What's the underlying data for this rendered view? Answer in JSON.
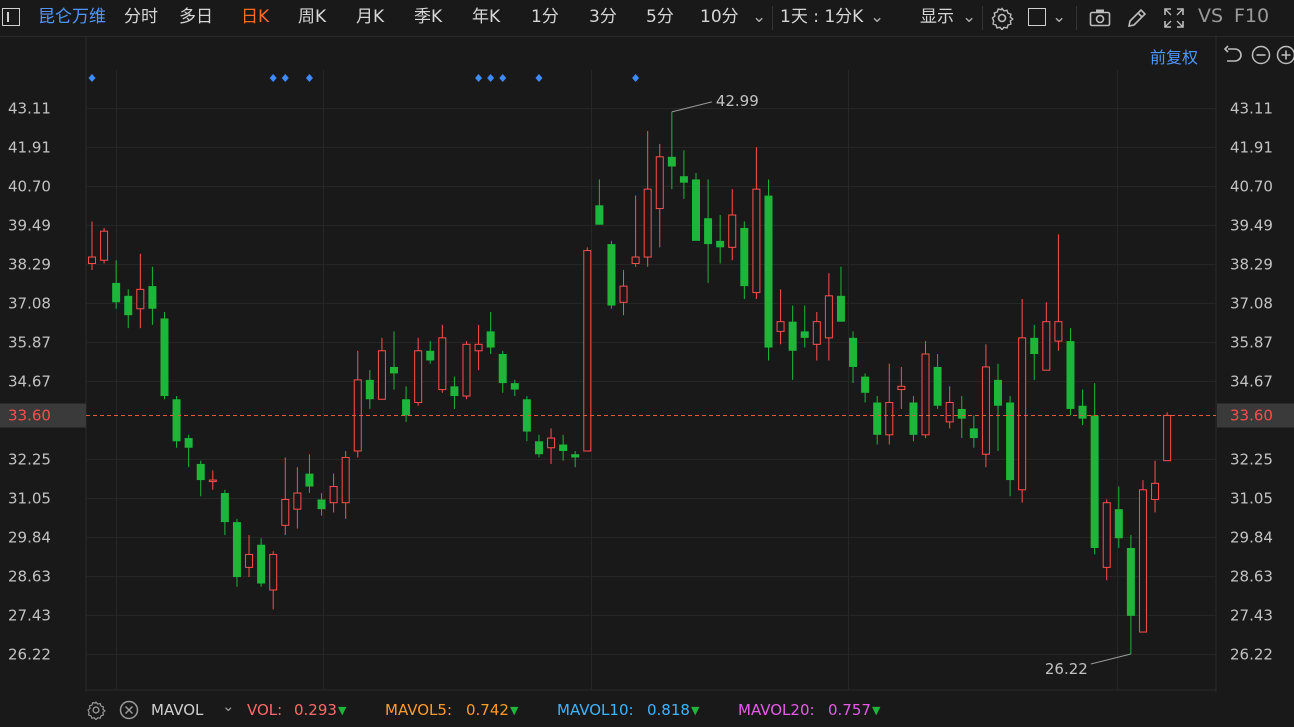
{
  "toolbar": {
    "title": "昆仑万维",
    "periods": [
      "分时",
      "多日",
      "日K",
      "周K",
      "月K",
      "季K",
      "年K",
      "1分",
      "3分",
      "5分",
      "10分"
    ],
    "active_period": "日K",
    "range_select": "1天 : 1分K",
    "display_label": "显示",
    "vs_label": "VS",
    "f10_label": "F10"
  },
  "sub": {
    "adjust_label": "前复权"
  },
  "colors": {
    "up": "#ff4d4d",
    "down": "#1db53a",
    "price_line": "#e8593c",
    "axis_text": "#c2c2c2",
    "title": "#4f97ff",
    "active": "#ff6a2b"
  },
  "bottom": {
    "indicator": "MAVOL",
    "vol": {
      "label": "VOL:",
      "value": "0.293",
      "color": "#ff6a6a"
    },
    "mavol5": {
      "label": "MAVOL5:",
      "value": "0.742",
      "color": "#ff9a2e"
    },
    "mavol10": {
      "label": "MAVOL10:",
      "value": "0.818",
      "color": "#3fb4ff"
    },
    "mavol20": {
      "label": "MAVOL20:",
      "value": "0.757",
      "color": "#e45ce8"
    }
  },
  "chart_data": {
    "type": "candlestick",
    "y_ticks": [
      "43.11",
      "41.91",
      "40.70",
      "39.49",
      "38.29",
      "37.08",
      "35.87",
      "34.67",
      "33.60",
      "32.25",
      "31.05",
      "29.84",
      "28.63",
      "27.43",
      "26.22"
    ],
    "ylim": [
      26.22,
      43.11
    ],
    "current_price": "33.60",
    "max_label": "42.99",
    "min_label": "26.22",
    "candles": [
      {
        "o": 38.3,
        "c": 38.5,
        "h": 39.6,
        "l": 38.1
      },
      {
        "o": 38.4,
        "c": 39.3,
        "h": 39.4,
        "l": 38.3
      },
      {
        "o": 37.7,
        "c": 37.1,
        "h": 38.4,
        "l": 36.9
      },
      {
        "o": 37.3,
        "c": 36.7,
        "h": 37.5,
        "l": 36.3
      },
      {
        "o": 36.9,
        "c": 37.5,
        "h": 38.6,
        "l": 36.3
      },
      {
        "o": 37.6,
        "c": 36.9,
        "h": 38.2,
        "l": 36.4
      },
      {
        "o": 36.6,
        "c": 34.2,
        "h": 36.8,
        "l": 34.1
      },
      {
        "o": 34.1,
        "c": 32.8,
        "h": 34.2,
        "l": 32.6
      },
      {
        "o": 32.9,
        "c": 32.6,
        "h": 33.0,
        "l": 32.0
      },
      {
        "o": 32.1,
        "c": 31.6,
        "h": 32.2,
        "l": 31.1
      },
      {
        "o": 31.6,
        "c": 31.6,
        "h": 31.9,
        "l": 31.3
      },
      {
        "o": 31.2,
        "c": 30.3,
        "h": 31.3,
        "l": 29.9
      },
      {
        "o": 30.3,
        "c": 28.6,
        "h": 30.4,
        "l": 28.3
      },
      {
        "o": 28.9,
        "c": 29.3,
        "h": 29.9,
        "l": 28.6
      },
      {
        "o": 29.6,
        "c": 28.4,
        "h": 29.8,
        "l": 28.3
      },
      {
        "o": 28.2,
        "c": 29.3,
        "h": 29.4,
        "l": 27.6
      },
      {
        "o": 30.2,
        "c": 31.0,
        "h": 32.3,
        "l": 29.9
      },
      {
        "o": 30.7,
        "c": 31.2,
        "h": 32.0,
        "l": 30.1
      },
      {
        "o": 31.8,
        "c": 31.4,
        "h": 32.4,
        "l": 31.2
      },
      {
        "o": 31.0,
        "c": 30.7,
        "h": 31.2,
        "l": 30.5
      },
      {
        "o": 30.9,
        "c": 31.4,
        "h": 31.8,
        "l": 30.6
      },
      {
        "o": 30.9,
        "c": 32.3,
        "h": 32.5,
        "l": 30.4
      },
      {
        "o": 32.5,
        "c": 34.7,
        "h": 35.6,
        "l": 32.3
      },
      {
        "o": 34.7,
        "c": 34.1,
        "h": 35.0,
        "l": 33.8
      },
      {
        "o": 34.1,
        "c": 35.6,
        "h": 36.0,
        "l": 34.1
      },
      {
        "o": 35.1,
        "c": 34.9,
        "h": 36.2,
        "l": 34.4
      },
      {
        "o": 34.1,
        "c": 33.6,
        "h": 34.5,
        "l": 33.4
      },
      {
        "o": 34.0,
        "c": 35.6,
        "h": 36.0,
        "l": 33.9
      },
      {
        "o": 35.6,
        "c": 35.3,
        "h": 35.9,
        "l": 35.2
      },
      {
        "o": 34.4,
        "c": 36.0,
        "h": 36.4,
        "l": 34.3
      },
      {
        "o": 34.5,
        "c": 34.2,
        "h": 34.8,
        "l": 33.8
      },
      {
        "o": 34.2,
        "c": 35.8,
        "h": 35.9,
        "l": 34.1
      },
      {
        "o": 35.6,
        "c": 35.8,
        "h": 36.4,
        "l": 35.0
      },
      {
        "o": 36.2,
        "c": 35.7,
        "h": 36.8,
        "l": 35.5
      },
      {
        "o": 35.5,
        "c": 34.6,
        "h": 35.6,
        "l": 34.3
      },
      {
        "o": 34.6,
        "c": 34.4,
        "h": 34.7,
        "l": 34.2
      },
      {
        "o": 34.1,
        "c": 33.1,
        "h": 34.2,
        "l": 32.8
      },
      {
        "o": 32.8,
        "c": 32.4,
        "h": 33.0,
        "l": 32.3
      },
      {
        "o": 32.6,
        "c": 32.9,
        "h": 33.2,
        "l": 32.1
      },
      {
        "o": 32.7,
        "c": 32.5,
        "h": 33.0,
        "l": 32.2
      },
      {
        "o": 32.4,
        "c": 32.3,
        "h": 32.5,
        "l": 32.0
      },
      {
        "o": 32.5,
        "c": 38.7,
        "h": 38.8,
        "l": 32.5
      },
      {
        "o": 40.1,
        "c": 39.5,
        "h": 40.9,
        "l": 39.5
      },
      {
        "o": 38.9,
        "c": 37.0,
        "h": 39.0,
        "l": 36.9
      },
      {
        "o": 37.1,
        "c": 37.6,
        "h": 38.1,
        "l": 36.7
      },
      {
        "o": 38.3,
        "c": 38.5,
        "h": 40.4,
        "l": 38.2
      },
      {
        "o": 38.5,
        "c": 40.6,
        "h": 42.4,
        "l": 38.2
      },
      {
        "o": 40.0,
        "c": 41.6,
        "h": 42.0,
        "l": 38.8
      },
      {
        "o": 41.6,
        "c": 41.3,
        "h": 42.99,
        "l": 40.6
      },
      {
        "o": 41.0,
        "c": 40.8,
        "h": 41.8,
        "l": 40.3
      },
      {
        "o": 40.9,
        "c": 39.0,
        "h": 41.1,
        "l": 39.4
      },
      {
        "o": 39.7,
        "c": 38.9,
        "h": 40.9,
        "l": 37.7
      },
      {
        "o": 39.0,
        "c": 38.8,
        "h": 39.8,
        "l": 38.3
      },
      {
        "o": 38.8,
        "c": 39.8,
        "h": 40.6,
        "l": 38.4
      },
      {
        "o": 39.4,
        "c": 37.6,
        "h": 39.6,
        "l": 37.2
      },
      {
        "o": 37.4,
        "c": 40.6,
        "h": 41.9,
        "l": 37.2
      },
      {
        "o": 40.4,
        "c": 35.7,
        "h": 40.9,
        "l": 35.3
      },
      {
        "o": 36.2,
        "c": 36.5,
        "h": 37.5,
        "l": 35.8
      },
      {
        "o": 36.5,
        "c": 35.6,
        "h": 37.0,
        "l": 34.7
      },
      {
        "o": 36.2,
        "c": 36.0,
        "h": 37.0,
        "l": 35.7
      },
      {
        "o": 35.8,
        "c": 36.5,
        "h": 36.8,
        "l": 35.3
      },
      {
        "o": 36.0,
        "c": 37.3,
        "h": 38.0,
        "l": 35.3
      },
      {
        "o": 37.3,
        "c": 36.5,
        "h": 38.2,
        "l": 36.5
      },
      {
        "o": 36.0,
        "c": 35.1,
        "h": 36.2,
        "l": 34.6
      },
      {
        "o": 34.8,
        "c": 34.3,
        "h": 34.9,
        "l": 34.0
      },
      {
        "o": 34.0,
        "c": 33.0,
        "h": 34.2,
        "l": 32.7
      },
      {
        "o": 33.0,
        "c": 34.0,
        "h": 35.2,
        "l": 32.7
      },
      {
        "o": 34.4,
        "c": 34.5,
        "h": 35.1,
        "l": 33.8
      },
      {
        "o": 34.0,
        "c": 33.0,
        "h": 34.2,
        "l": 32.8
      },
      {
        "o": 33.0,
        "c": 35.5,
        "h": 35.9,
        "l": 32.9
      },
      {
        "o": 35.1,
        "c": 33.9,
        "h": 35.5,
        "l": 33.8
      },
      {
        "o": 33.4,
        "c": 34.0,
        "h": 34.5,
        "l": 33.2
      },
      {
        "o": 33.8,
        "c": 33.5,
        "h": 34.2,
        "l": 32.9
      },
      {
        "o": 33.2,
        "c": 32.9,
        "h": 33.6,
        "l": 32.6
      },
      {
        "o": 32.4,
        "c": 35.1,
        "h": 35.8,
        "l": 32.0
      },
      {
        "o": 34.7,
        "c": 33.9,
        "h": 35.2,
        "l": 32.5
      },
      {
        "o": 34.0,
        "c": 31.6,
        "h": 34.2,
        "l": 31.1
      },
      {
        "o": 31.3,
        "c": 36.0,
        "h": 37.2,
        "l": 30.9
      },
      {
        "o": 36.0,
        "c": 35.5,
        "h": 36.4,
        "l": 34.7
      },
      {
        "o": 35.0,
        "c": 36.5,
        "h": 37.1,
        "l": 35.0
      },
      {
        "o": 35.9,
        "c": 36.5,
        "h": 39.2,
        "l": 35.6
      },
      {
        "o": 35.9,
        "c": 33.8,
        "h": 36.3,
        "l": 33.6
      },
      {
        "o": 33.9,
        "c": 33.5,
        "h": 34.4,
        "l": 33.3
      },
      {
        "o": 33.6,
        "c": 29.5,
        "h": 34.6,
        "l": 29.3
      },
      {
        "o": 28.9,
        "c": 30.9,
        "h": 31.0,
        "l": 28.5
      },
      {
        "o": 30.7,
        "c": 29.8,
        "h": 31.4,
        "l": 29.5
      },
      {
        "o": 29.5,
        "c": 27.4,
        "h": 29.9,
        "l": 26.22
      },
      {
        "o": 26.9,
        "c": 31.3,
        "h": 31.6,
        "l": 26.9
      },
      {
        "o": 31.0,
        "c": 31.5,
        "h": 32.2,
        "l": 30.6
      },
      {
        "o": 32.2,
        "c": 33.6,
        "h": 33.7,
        "l": 32.2
      }
    ],
    "marker_candle_indices": [
      0,
      15,
      16,
      18,
      32,
      33,
      34,
      37,
      45
    ]
  }
}
